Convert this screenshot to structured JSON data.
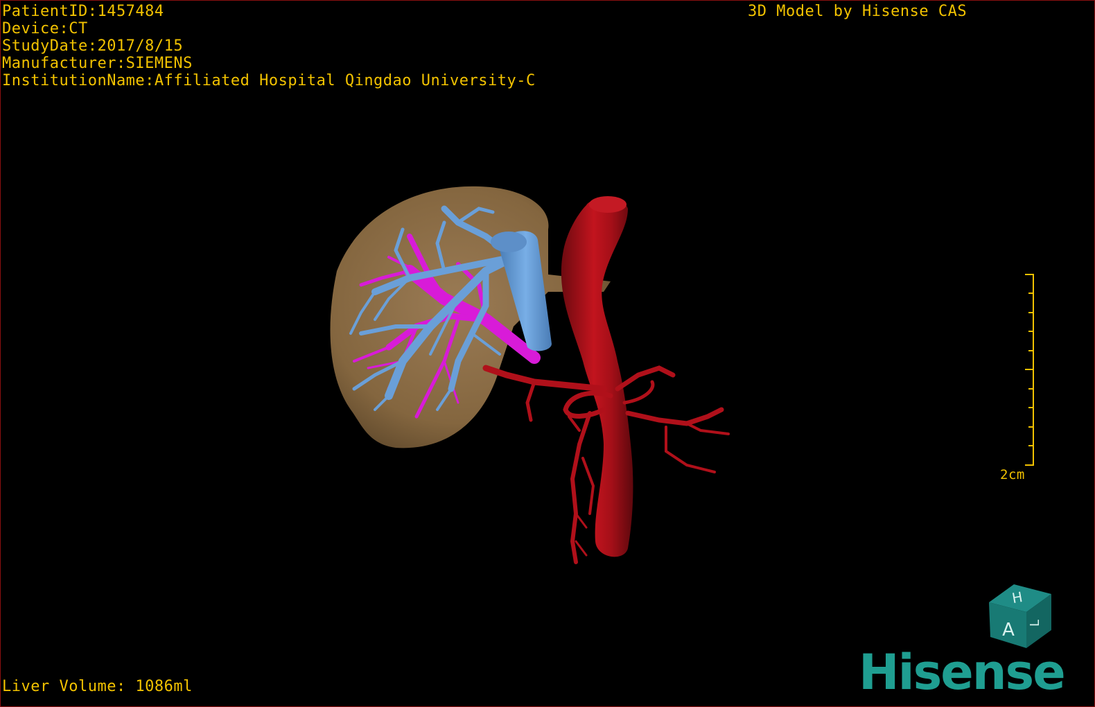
{
  "overlay": {
    "patient_id": "PatientID:1457484",
    "device": "Device:CT",
    "study_date": "StudyDate:2017/8/15",
    "manufacturer": "Manufacturer:SIEMENS",
    "institution": "InstitutionName:Affiliated Hospital Qingdao University-C",
    "model_title": "3D Model by Hisense CAS",
    "liver_volume": "Liver Volume: 1086ml",
    "scale_label": "2cm"
  },
  "orientation_cube": {
    "face_top": "H",
    "face_front": "A",
    "face_side": "L"
  },
  "brand": {
    "logo_text": "Hisense",
    "color": "#1f9e91"
  },
  "colors": {
    "overlay_text": "#f2c200",
    "liver": "#8a6a45",
    "hepatic_vein": "#6a9fd8",
    "portal_vein": "#d81bd8",
    "artery": "#b0101a",
    "viewport_border": "#8b1010"
  }
}
